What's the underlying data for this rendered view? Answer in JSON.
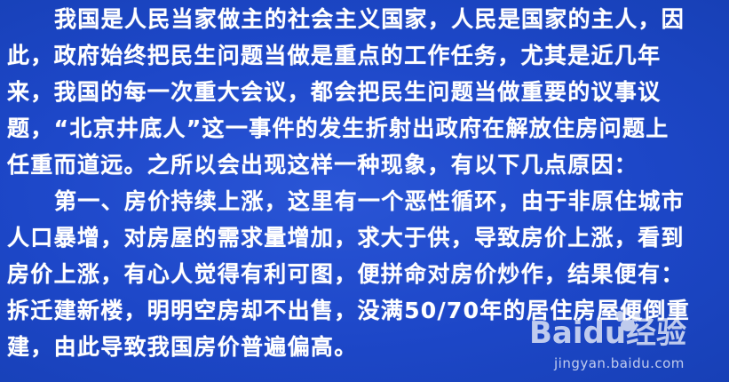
{
  "document": {
    "lines": [
      "我国是人民当家做主的社会主义国家，人民是国家的主人，因",
      "此，政府始终把民生问题当做是重点的工作任务，尤其是近几年",
      "来，我国的每一次重大会议，都会把民生问题当做重要的议事议",
      "题，“北京井底人”这一事件的发生折射出政府在解放住房问题上",
      "任重而道远。之所以会出现这样一种现象，有以下几点原因：",
      "第一、房价持续上涨，这里有一个恶性循环，由于非原住城市",
      "人口暴增，对房屋的需求量增加，求大于供，导致房价上涨，看到",
      "房价上涨，有心人觉得有利可图，便拼命对房价炒作，结果便有：",
      "拆迁建新楼，明明空房却不出售，没满50/70年的居住房屋便倒重",
      "建，由此导致我国房价普遍偏高。"
    ]
  },
  "watermark": {
    "logo_text": "Baidu经验",
    "url": "jingyan.baidu.com"
  },
  "colors": {
    "background": "#1d47c8",
    "text": "#ffffff"
  }
}
